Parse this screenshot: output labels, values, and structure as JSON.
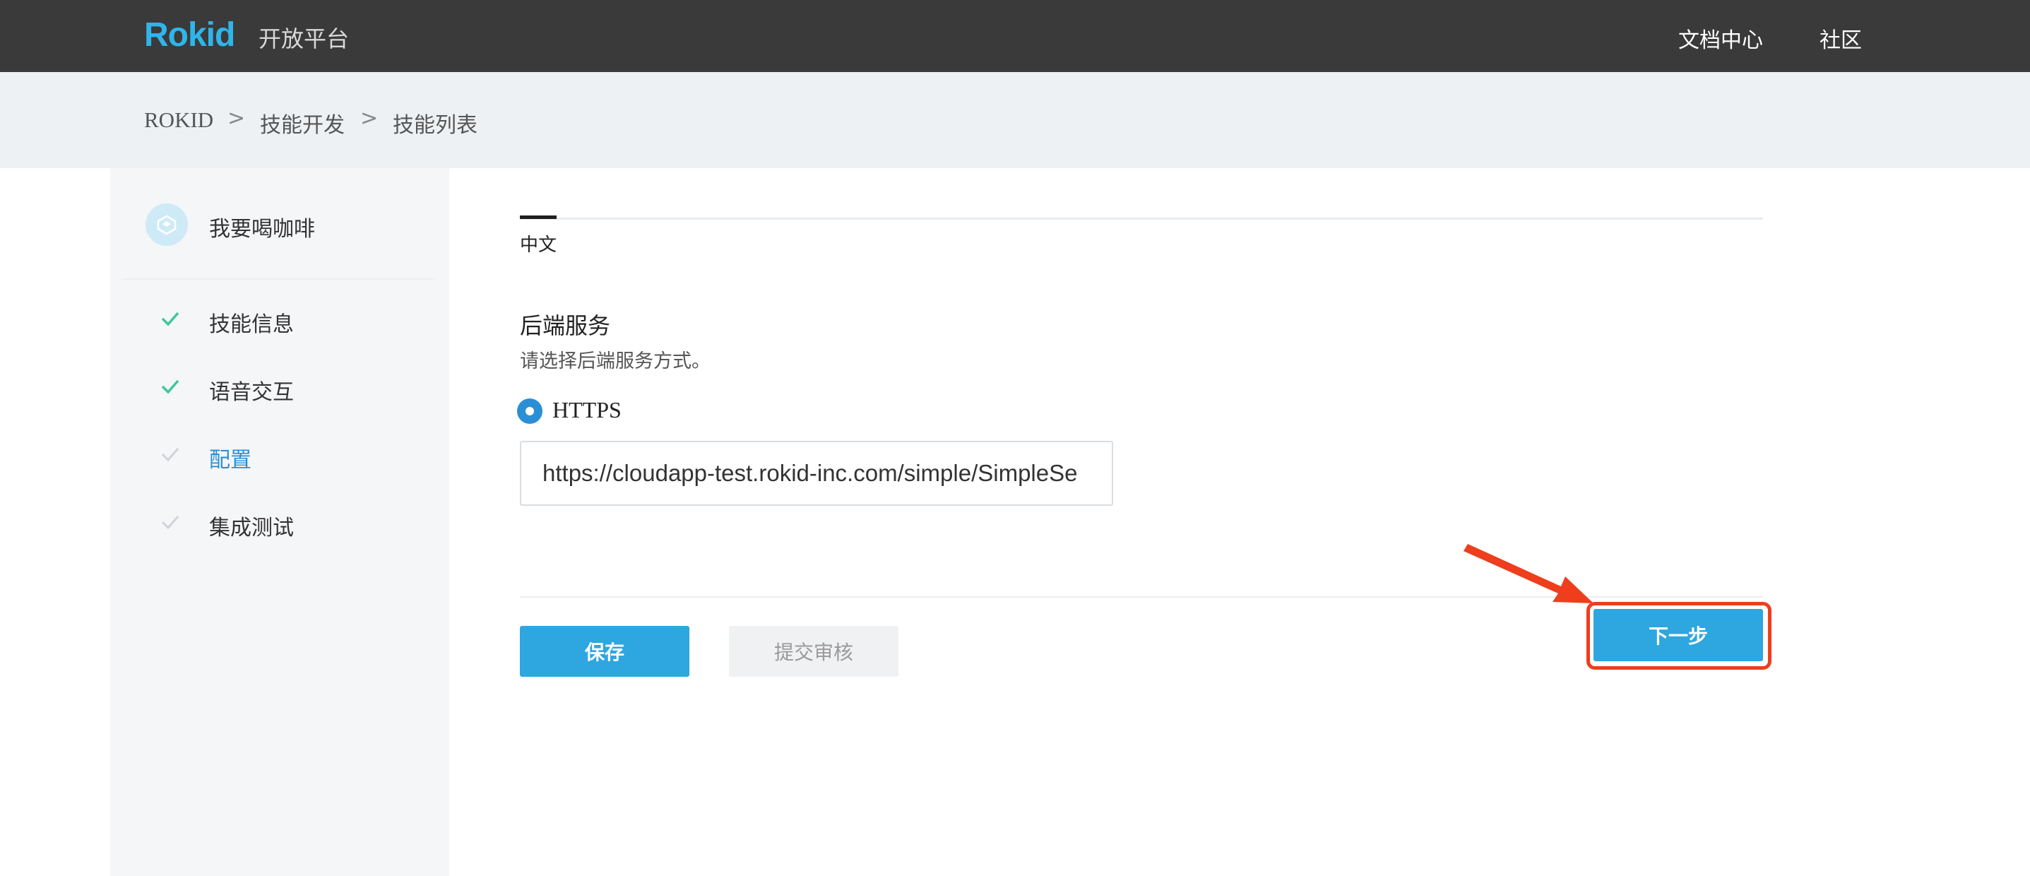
{
  "header": {
    "logo_text": "Rokid",
    "platform_label": "开放平台",
    "nav": [
      {
        "label": "文档中心"
      },
      {
        "label": "社区"
      }
    ]
  },
  "breadcrumb": {
    "items": [
      {
        "label": "ROKID"
      },
      {
        "label": "技能开发"
      },
      {
        "label": "技能列表"
      }
    ],
    "separator": ">"
  },
  "sidebar": {
    "skill_name": "我要喝咖啡",
    "items": [
      {
        "label": "技能信息",
        "status": "done"
      },
      {
        "label": "语音交互",
        "status": "done"
      },
      {
        "label": "配置",
        "status": "current"
      },
      {
        "label": "集成测试",
        "status": "todo"
      }
    ]
  },
  "main": {
    "tabs": [
      {
        "label": "中文"
      }
    ],
    "section_title": "后端服务",
    "section_desc": "请选择后端服务方式。",
    "radio_option": "HTTPS",
    "endpoint_url": "https://cloudapp-test.rokid-inc.com/simple/SimpleSe"
  },
  "actions": {
    "save_label": "保存",
    "submit_label": "提交审核",
    "next_label": "下一步"
  },
  "colors": {
    "brand": "#2fb5ea",
    "header_bg": "#3a3a3a",
    "primary_button": "#2ea6e0",
    "check_done": "#3cc79a",
    "check_todo": "#d0d4d8",
    "annotation": "#ee3e1d",
    "active_link": "#2a8fd4"
  }
}
